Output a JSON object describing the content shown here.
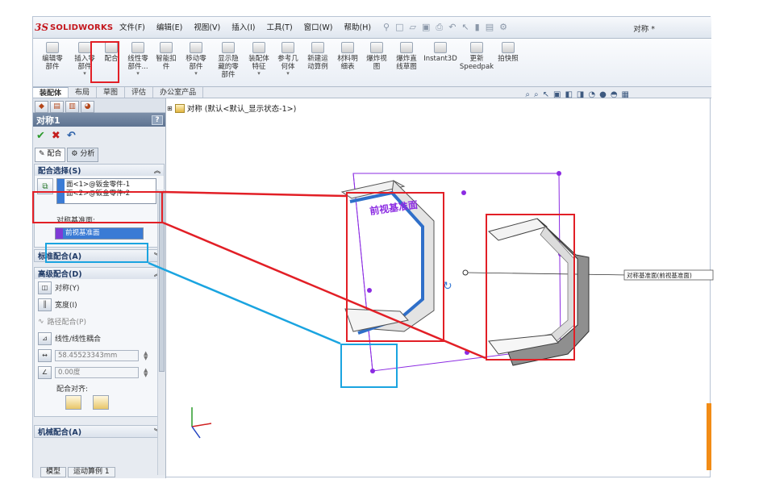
{
  "app": {
    "logo_ds": "3S",
    "logo_sw": "SOLIDWORKS",
    "doc_title": "对称 *"
  },
  "menu": [
    "文件(F)",
    "编辑(E)",
    "视图(V)",
    "插入(I)",
    "工具(T)",
    "窗口(W)",
    "帮助(H)"
  ],
  "ribbon": [
    {
      "label": "编辑零\n部件",
      "icon": "edit-component-icon",
      "dd": false
    },
    {
      "label": "插入零\n部件",
      "icon": "insert-component-icon",
      "dd": true
    },
    {
      "label": "配合",
      "icon": "mate-paperclip-icon",
      "dd": false
    },
    {
      "label": "线性零\n部件...",
      "icon": "linear-pattern-icon",
      "dd": true
    },
    {
      "label": "智能扣\n件",
      "icon": "smart-fastener-icon",
      "dd": false
    },
    {
      "label": "移动零\n部件",
      "icon": "move-component-icon",
      "dd": true
    },
    {
      "label": "显示隐\n藏的零\n部件",
      "icon": "show-hidden-icon",
      "dd": false
    },
    {
      "label": "装配体\n特征",
      "icon": "assembly-feature-icon",
      "dd": true
    },
    {
      "label": "参考几\n何体",
      "icon": "reference-geometry-icon",
      "dd": true
    },
    {
      "label": "新建运\n动算例",
      "icon": "new-motion-study-icon",
      "dd": false
    },
    {
      "label": "材料明\n细表",
      "icon": "bom-icon",
      "dd": false
    },
    {
      "label": "爆炸视\n图",
      "icon": "exploded-view-icon",
      "dd": false
    },
    {
      "label": "爆炸直\n线草图",
      "icon": "explode-line-sketch-icon",
      "dd": false
    },
    {
      "label": "Instant3D",
      "icon": "instant3d-icon",
      "dd": false
    },
    {
      "label": "更新\nSpeedpak",
      "icon": "speedpak-icon",
      "dd": false
    },
    {
      "label": "拍快照",
      "icon": "snapshot-icon",
      "dd": false
    }
  ],
  "tabs": [
    "装配体",
    "布局",
    "草图",
    "评估",
    "办公室产品"
  ],
  "tree_node": "对称 (默认<默认_显示状态-1>)",
  "panel": {
    "title": "对称1",
    "help": "?",
    "subtab_mates": "配合",
    "subtab_analysis": "分析",
    "mate_selections_header": "配合选择(S)",
    "selections": [
      "面<1>@钣金零件-1",
      "面<2>@钣金零件-2"
    ],
    "symmetry_plane_label": "对称基准面:",
    "symmetry_plane_value": "前视基准面",
    "standard_header": "标准配合(A)",
    "advanced_header": "高级配合(D)",
    "symmetric": "对称(Y)",
    "width": "宽度(I)",
    "path": "路径配合(P)",
    "linear": "线性/线性耦合",
    "distance_value": "58.45523343mm",
    "angle_value": "0.00度",
    "alignment_label": "配合对齐:",
    "mechanical_header": "机械配合(A)"
  },
  "bottom_tabs": [
    "模型",
    "运动算例 1"
  ],
  "viewport": {
    "plane_label": "前视基准面",
    "callout": "对称基准面(前视基准面)"
  },
  "colors": {
    "accent_red": "#e21f26",
    "accent_blue": "#1aa4e0",
    "plane_purple": "#8b2be2",
    "selection_blue": "#2f6fc9"
  }
}
